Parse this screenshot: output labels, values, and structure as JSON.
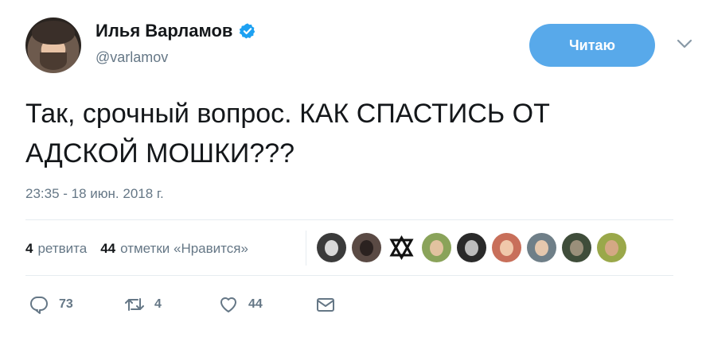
{
  "user": {
    "display_name": "Илья Варламов",
    "handle": "@varlamov"
  },
  "follow_button": {
    "label": "Читаю"
  },
  "tweet": {
    "text_line1": "Так, срочный вопрос. КАК СПАСТИСЬ ОТ",
    "text_line2": "АДСКОЙ МОШКИ???",
    "timestamp": "23:35 - 18 июн. 2018 г."
  },
  "stats": {
    "retweets_count": "4",
    "retweets_label": "ретвита",
    "likes_count": "44",
    "likes_label": "отметки «Нравится»"
  },
  "actions": {
    "reply_count": "73",
    "retweet_count": "4",
    "like_count": "44"
  },
  "colors": {
    "accent": "#58a9ea",
    "verified": "#1da1f2",
    "muted": "#657786",
    "text": "#14171a",
    "divider": "#e6ecf0"
  },
  "icons": [
    "verified-badge-icon",
    "chevron-down-icon",
    "reply-icon",
    "retweet-icon",
    "heart-icon",
    "envelope-icon"
  ]
}
